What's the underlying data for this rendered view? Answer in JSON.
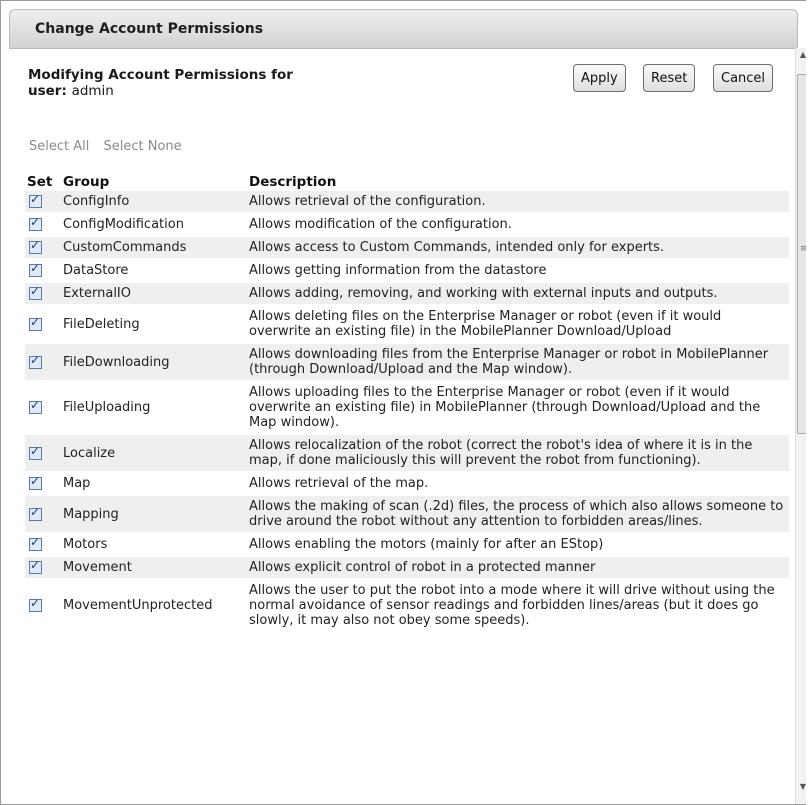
{
  "dialog": {
    "title": "Change Account Permissions",
    "heading_line1": "Modifying Account Permissions for",
    "heading_user_label": "user:",
    "heading_user": "admin"
  },
  "buttons": {
    "apply": "Apply",
    "reset": "Reset",
    "cancel": "Cancel"
  },
  "selection": {
    "select_all": "Select All",
    "select_none": "Select None"
  },
  "table": {
    "headers": {
      "set": "Set",
      "group": "Group",
      "description": "Description"
    },
    "rows": [
      {
        "group": "ConfigInfo",
        "description": "Allows retrieval of the configuration.",
        "checked": true
      },
      {
        "group": "ConfigModification",
        "description": "Allows modification of the configuration.",
        "checked": true
      },
      {
        "group": "CustomCommands",
        "description": "Allows access to Custom Commands, intended only for experts.",
        "checked": true
      },
      {
        "group": "DataStore",
        "description": "Allows getting information from the datastore",
        "checked": true
      },
      {
        "group": "ExternalIO",
        "description": "Allows adding, removing, and working with external inputs and outputs.",
        "checked": true
      },
      {
        "group": "FileDeleting",
        "description": "Allows deleting files on the Enterprise Manager or robot (even if it would overwrite an existing file) in the MobilePlanner Download/Upload",
        "checked": true
      },
      {
        "group": "FileDownloading",
        "description": "Allows downloading files from the Enterprise Manager or robot in MobilePlanner (through Download/Upload and the Map window).",
        "checked": true
      },
      {
        "group": "FileUploading",
        "description": "Allows uploading files to the Enterprise Manager or robot (even if it would overwrite an existing file) in MobilePlanner (through Download/Upload and the Map window).",
        "checked": true
      },
      {
        "group": "Localize",
        "description": "Allows relocalization of the robot (correct the robot's idea of where it is in the map, if done maliciously this will prevent the robot from functioning).",
        "checked": true
      },
      {
        "group": "Map",
        "description": "Allows retrieval of the map.",
        "checked": true
      },
      {
        "group": "Mapping",
        "description": "Allows the making of scan (.2d) files, the process of which also allows someone to drive around the robot without any attention to forbidden areas/lines.",
        "checked": true
      },
      {
        "group": "Motors",
        "description": "Allows enabling the motors (mainly for after an EStop)",
        "checked": true
      },
      {
        "group": "Movement",
        "description": "Allows explicit control of robot in a protected manner",
        "checked": true
      },
      {
        "group": "MovementUnprotected",
        "description": "Allows the user to put the robot into a mode where it will drive without using the normal avoidance of sensor readings and forbidden lines/areas (but it does go slowly, it may also not obey some speeds).",
        "checked": true
      }
    ]
  },
  "scrollbar": {
    "position": 0.0
  }
}
